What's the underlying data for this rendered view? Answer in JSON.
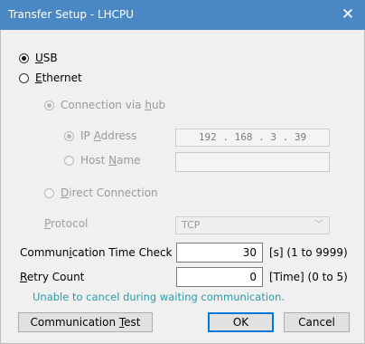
{
  "window": {
    "title": "Transfer Setup - LHCPU",
    "close_glyph": "✕"
  },
  "connection": {
    "usb_label": "USB",
    "ethernet_label": "Ethernet",
    "via_hub_label": "Connection via hub",
    "ip_address_label": "IP Address",
    "ip_value": "192 . 168 .   3 .  39",
    "host_name_label": "Host Name",
    "host_name_value": "",
    "direct_label": "Direct Connection",
    "protocol_label": "Protocol",
    "protocol_value": "TCP"
  },
  "timing": {
    "comm_time_label": "Communication Time Check",
    "comm_time_value": "30",
    "comm_time_unit": "[s]  (1 to 9999)",
    "retry_label": "Retry Count",
    "retry_value": "0",
    "retry_unit": "[Time]  (0 to 5)",
    "note": "Unable to cancel during waiting communication."
  },
  "buttons": {
    "comm_test": "Communication Test",
    "ok": "OK",
    "cancel": "Cancel"
  },
  "colors": {
    "title_bar": "#4a88c5",
    "note_text": "#2b9aab",
    "default_button_border": "#0078d7"
  }
}
